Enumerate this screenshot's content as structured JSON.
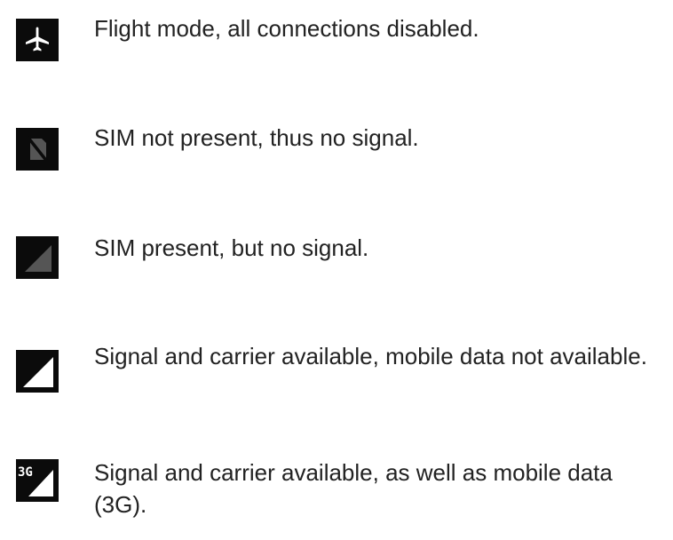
{
  "items": [
    {
      "icon": "airplane-icon",
      "text": "Flight mode, all connections disabled."
    },
    {
      "icon": "no-sim-icon",
      "text": "SIM not present, thus no signal."
    },
    {
      "icon": "signal-empty-icon",
      "text": "SIM present, but no signal."
    },
    {
      "icon": "signal-full-icon",
      "text": "Signal and carrier available, mobile data not available."
    },
    {
      "icon": "signal-3g-icon",
      "text": "Signal and carrier available, as well as mobile data (3G).",
      "badge": "3G"
    }
  ],
  "colors": {
    "icon_background": "#0b0b0b",
    "icon_white": "#ffffff",
    "icon_gray": "#555555",
    "text": "#222222"
  }
}
